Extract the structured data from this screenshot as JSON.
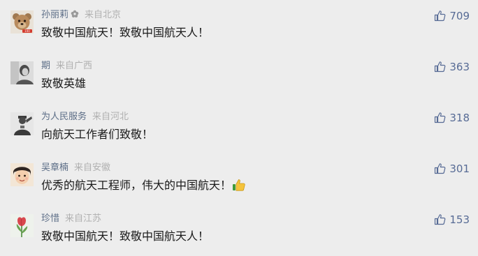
{
  "comments": [
    {
      "nickname": "孙丽莉",
      "location": "来自北京",
      "text": "致敬中国航天！致敬中国航天人！",
      "likes": "709",
      "avatar": "teddy-bear-avatar",
      "has_badge": true
    },
    {
      "nickname": "期",
      "location": "来自广西",
      "text": "致敬英雄",
      "likes": "363",
      "avatar": "grey-portrait-avatar"
    },
    {
      "nickname": "为人民服务",
      "location": "来自河北",
      "text": "向航天工作者们致敬！",
      "likes": "318",
      "avatar": "saluting-soldier-avatar"
    },
    {
      "nickname": "吴章楠",
      "location": "来自安徽",
      "text": "优秀的航天工程师，伟大的中国航天！",
      "likes": "301",
      "avatar": "child-face-avatar",
      "emoji": "thumbs-up-emoji"
    },
    {
      "nickname": "珍惜",
      "location": "来自江苏",
      "text": "致敬中国航天！致敬中国航天人！",
      "likes": "153",
      "avatar": "tulip-flower-avatar"
    }
  ],
  "colors": {
    "background": "#ededed",
    "nickname": "#5c6d86",
    "location": "#b0b0b0",
    "text": "#1a1a1a",
    "like": "#576b95"
  }
}
